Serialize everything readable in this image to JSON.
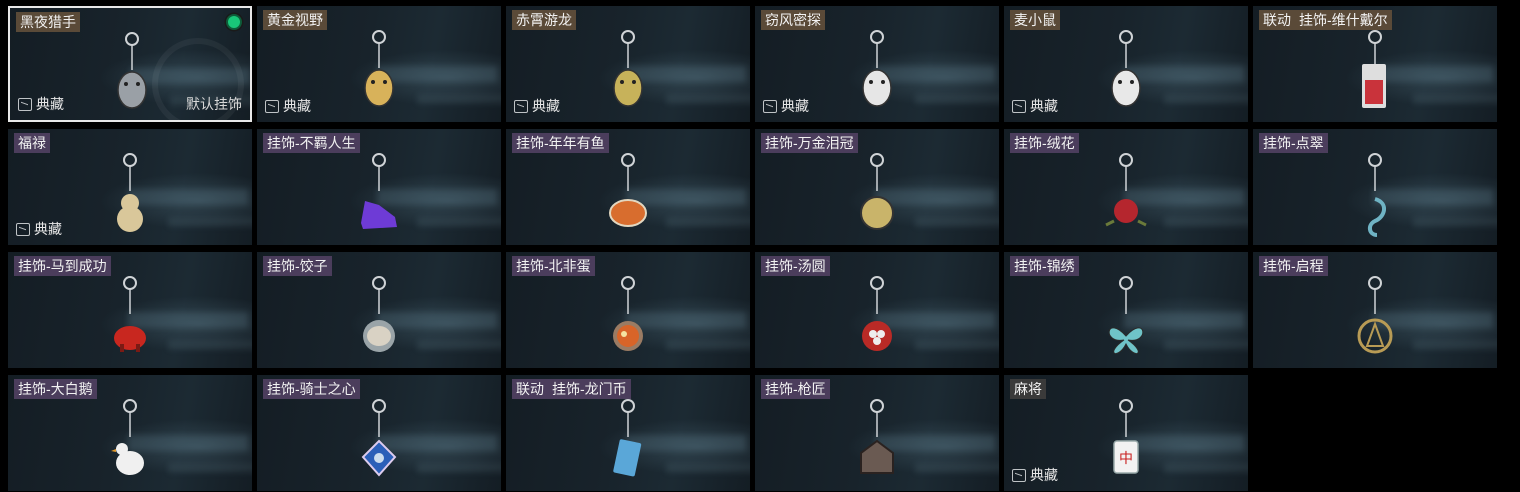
{
  "collection_label": "典藏",
  "default_charm_label": "默认挂饰",
  "items": [
    {
      "tags": [
        {
          "text": "黑夜猎手",
          "style": "gold"
        }
      ],
      "collectible": true,
      "default": true,
      "equipped": true,
      "selected": true,
      "charm": "gray-creature-charm-icon",
      "color": "#9aa0a6"
    },
    {
      "tags": [
        {
          "text": "黄金视野",
          "style": "gold"
        }
      ],
      "collectible": true,
      "charm": "gold-creature-charm-icon",
      "color": "#d8b25a"
    },
    {
      "tags": [
        {
          "text": "赤霄游龙",
          "style": "gold"
        }
      ],
      "collectible": true,
      "charm": "dragon-charm-icon",
      "color": "#c7b25a"
    },
    {
      "tags": [
        {
          "text": "窃风密探",
          "style": "gold"
        }
      ],
      "collectible": true,
      "charm": "rabbit-charm-icon",
      "color": "#e6e6e6"
    },
    {
      "tags": [
        {
          "text": "麦小鼠",
          "style": "gold"
        }
      ],
      "collectible": true,
      "charm": "mouse-charm-icon",
      "color": "#e8e8e8"
    },
    {
      "tags": [
        {
          "text": "联动",
          "style": "gold"
        },
        {
          "text": "挂饰-维什戴尔",
          "style": "gold"
        }
      ],
      "collectible": false,
      "charm": "red-card-charm-icon",
      "color": "#c9333b"
    },
    {
      "tags": [
        {
          "text": "福禄",
          "style": "purple"
        }
      ],
      "collectible": true,
      "charm": "gourd-charm-icon",
      "color": "#d9c79a"
    },
    {
      "tags": [
        {
          "text": "挂饰-不羁人生",
          "style": "purple"
        }
      ],
      "collectible": false,
      "charm": "sneaker-charm-icon",
      "color": "#6e3bd6"
    },
    {
      "tags": [
        {
          "text": "挂饰-年年有鱼",
          "style": "purple"
        }
      ],
      "collectible": false,
      "charm": "fish-charm-icon",
      "color": "#d86d2e"
    },
    {
      "tags": [
        {
          "text": "挂饰-万金泪冠",
          "style": "purple"
        }
      ],
      "collectible": false,
      "charm": "coin-charm-icon",
      "color": "#c9b46a"
    },
    {
      "tags": [
        {
          "text": "挂饰-绒花",
          "style": "purple"
        }
      ],
      "collectible": false,
      "charm": "rose-charm-icon",
      "color": "#b5262e"
    },
    {
      "tags": [
        {
          "text": "挂饰-点翠",
          "style": "purple"
        }
      ],
      "collectible": false,
      "charm": "phoenix-charm-icon",
      "color": "#6fb3c4"
    },
    {
      "tags": [
        {
          "text": "挂饰-马到成功",
          "style": "purple"
        }
      ],
      "collectible": false,
      "charm": "horse-charm-icon",
      "color": "#c8271f"
    },
    {
      "tags": [
        {
          "text": "挂饰-饺子",
          "style": "purple"
        }
      ],
      "collectible": false,
      "charm": "dumpling-charm-icon",
      "color": "#d9d2c4"
    },
    {
      "tags": [
        {
          "text": "挂饰-北非蛋",
          "style": "purple"
        }
      ],
      "collectible": false,
      "charm": "shakshuka-charm-icon",
      "color": "#d86428"
    },
    {
      "tags": [
        {
          "text": "挂饰-汤圆",
          "style": "purple"
        }
      ],
      "collectible": false,
      "charm": "tangyuan-charm-icon",
      "color": "#b92a26"
    },
    {
      "tags": [
        {
          "text": "挂饰-锦绣",
          "style": "purple"
        }
      ],
      "collectible": false,
      "charm": "butterfly-charm-icon",
      "color": "#6fc3c8"
    },
    {
      "tags": [
        {
          "text": "挂饰-启程",
          "style": "purple"
        }
      ],
      "collectible": false,
      "charm": "compass-charm-icon",
      "color": "#b89b55"
    },
    {
      "tags": [
        {
          "text": "挂饰-大白鹅",
          "style": "purple"
        }
      ],
      "collectible": false,
      "charm": "goose-charm-icon",
      "color": "#f0f0f0"
    },
    {
      "tags": [
        {
          "text": "挂饰-骑士之心",
          "style": "purple"
        }
      ],
      "collectible": false,
      "charm": "cross-shield-charm-icon",
      "color": "#2b5fb8"
    },
    {
      "tags": [
        {
          "text": "联动",
          "style": "purple"
        },
        {
          "text": "挂饰-龙门币",
          "style": "purple"
        }
      ],
      "collectible": false,
      "charm": "card-charm-icon",
      "color": "#5aa7d8"
    },
    {
      "tags": [
        {
          "text": "挂饰-枪匠",
          "style": "purple"
        }
      ],
      "collectible": false,
      "charm": "house-charm-icon",
      "color": "#6a5a52"
    },
    {
      "tags": [
        {
          "text": "麻将",
          "style": "plain"
        }
      ],
      "collectible": true,
      "charm": "mahjong-charm-icon",
      "color": "#f2f2f2"
    }
  ]
}
